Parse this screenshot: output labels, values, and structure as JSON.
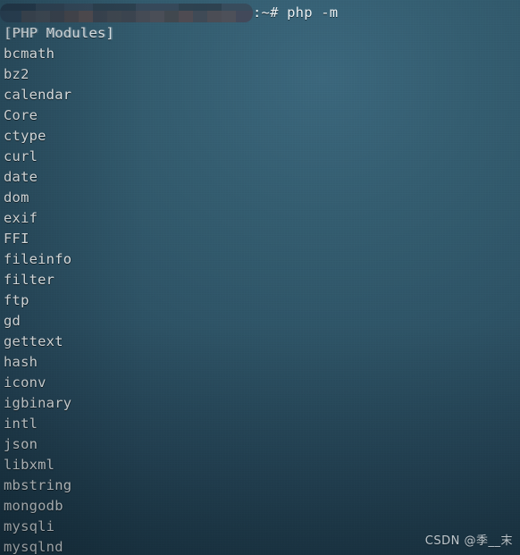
{
  "terminal": {
    "prompt": {
      "redacted_user_host": "",
      "text": ":~# php -m"
    },
    "header": "[PHP Modules]",
    "modules": [
      "bcmath",
      "bz2",
      "calendar",
      "Core",
      "ctype",
      "curl",
      "date",
      "dom",
      "exif",
      "FFI",
      "fileinfo",
      "filter",
      "ftp",
      "gd",
      "gettext",
      "hash",
      "iconv",
      "igbinary",
      "intl",
      "json",
      "libxml",
      "mbstring",
      "mongodb",
      "mysqli",
      "mysqlnd"
    ]
  },
  "watermark": {
    "text": "CSDN @季__末"
  },
  "colors": {
    "background_top": "#3a657a",
    "background_mid": "#2d5264",
    "background_bottom": "#17303e",
    "text": "#edf1f2",
    "watermark": "#e8eef1"
  }
}
